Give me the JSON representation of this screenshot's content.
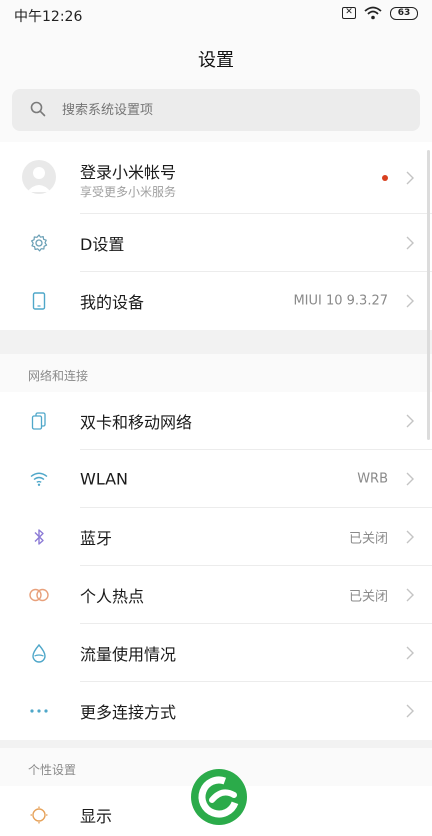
{
  "status": {
    "time": "中午12:26",
    "sim": "✕",
    "battery": "63"
  },
  "title": "设置",
  "search": {
    "placeholder": "搜索系统设置项"
  },
  "account": {
    "title": "登录小米帐号",
    "subtitle": "享受更多小米服务"
  },
  "top_items": [
    {
      "label": "D设置",
      "value": ""
    },
    {
      "label": "我的设备",
      "value": "MIUI 10 9.3.27"
    }
  ],
  "network": {
    "header": "网络和连接",
    "items": [
      {
        "label": "双卡和移动网络",
        "value": ""
      },
      {
        "label": "WLAN",
        "value": "WRB"
      },
      {
        "label": "蓝牙",
        "value": "已关闭"
      },
      {
        "label": "个人热点",
        "value": "已关闭"
      },
      {
        "label": "流量使用情况",
        "value": ""
      },
      {
        "label": "更多连接方式",
        "value": ""
      }
    ]
  },
  "personal": {
    "header": "个性设置",
    "items": [
      {
        "label": "显示",
        "value": ""
      }
    ]
  },
  "colors": {
    "accent": "#4fa7c9",
    "bluetooth": "#8c7bd6",
    "hotspot": "#e8a07b",
    "display": "#e6a25a",
    "dot": "#d8401f",
    "logo": "#2bab4a"
  },
  "icons": [
    "gear-icon",
    "phone-icon",
    "dual-sim-icon",
    "wifi-icon",
    "bluetooth-icon",
    "hotspot-icon",
    "water-drop-icon",
    "more-dots-icon",
    "sun-icon",
    "chevron-right-icon",
    "search-icon"
  ]
}
